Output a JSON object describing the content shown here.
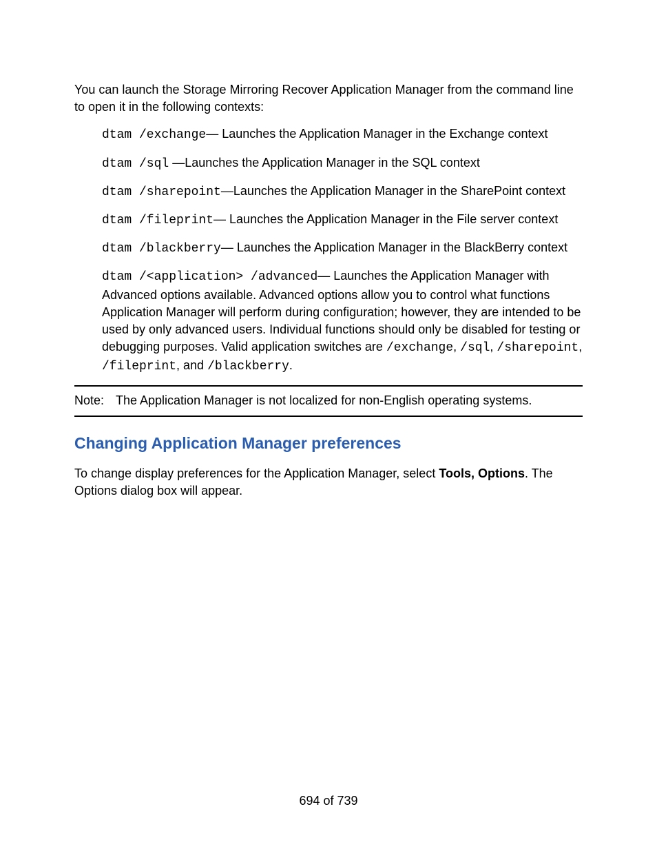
{
  "intro": "You can launch the Storage Mirroring Recover Application Manager from the command line to open it in the following contexts:",
  "commands": [
    {
      "cmd": "dtam /exchange",
      "desc": "— Launches the Application Manager in the Exchange context"
    },
    {
      "cmd": "dtam /sql",
      "desc": " —Launches the Application Manager in the SQL context"
    },
    {
      "cmd": "dtam /sharepoint",
      "desc": "—Launches the Application Manager in the SharePoint context"
    },
    {
      "cmd": "dtam /fileprint",
      "desc": "— Launches the Application Manager in the File server context"
    },
    {
      "cmd": "dtam /blackberry",
      "desc": "— Launches the Application Manager in the BlackBerry context"
    }
  ],
  "advanced": {
    "cmd": "dtam /<application> /advanced",
    "desc_pre": "— Launches the Application Manager with Advanced options available. Advanced options allow you to control what functions Application Manager will perform during configuration; however, they are intended to be used by only advanced users. Individual functions should only be disabled for testing or debugging purposes. Valid application switches are ",
    "sw0": "/exchange",
    "c0": ", ",
    "sw1": "/sql",
    "c1": ", ",
    "sw2": "/sharepoint",
    "c2": ", ",
    "sw3": "/fileprint",
    "c3": ", and ",
    "sw4": "/blackberry",
    "c4": "."
  },
  "note": {
    "label": "Note:",
    "text": "The Application Manager is not localized for non-English operating systems."
  },
  "section": {
    "heading": "Changing Application Manager preferences",
    "para_pre": "To change display preferences for the Application Manager, select ",
    "bold": "Tools, Options",
    "para_post": ". The Options dialog box will appear."
  },
  "pageNumber": "694 of 739"
}
